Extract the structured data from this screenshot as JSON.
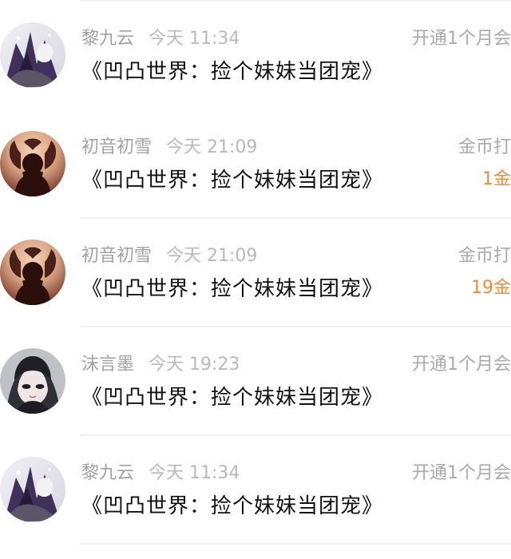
{
  "rows": [
    {
      "avatar": "silhouette-heart-avatar",
      "name": "初音初雪",
      "time": "今天 21:09",
      "title": "《凹凸世界：捡个妹妹当团宠》",
      "right_text": "金币打",
      "right_amount": "1金"
    },
    {
      "avatar": "silhouette-heart-avatar",
      "name": "初音初雪",
      "time": "今天 21:09",
      "title": "《凹凸世界：捡个妹妹当团宠》",
      "right_text": "金币打",
      "right_amount": "19金"
    },
    {
      "avatar": "anime-girl-avatar",
      "name": "沫言墨",
      "time": "今天 19:23",
      "title": "《凹凸世界：捡个妹妹当团宠》",
      "right_text": "开通1个月会",
      "right_amount": ""
    },
    {
      "avatar": "anime-dark-avatar",
      "name": "黎九云",
      "time": "今天 11:34",
      "title": "《凹凸世界：捡个妹妹当团宠》",
      "right_text": "开通1个月会",
      "right_amount": ""
    },
    {
      "avatar": "anime-dark-avatar",
      "name": "黎九云",
      "time": "今天 11:34",
      "title": "《凹凸世界：捡个妹妹当团宠》",
      "right_text": "开通1个月会",
      "right_amount": ""
    }
  ],
  "colors": {
    "name": "#a1a1a1",
    "time": "#b9b9b9",
    "title": "#111111",
    "right_text": "#a9a9a9",
    "amount": "#f08a36",
    "divider": "#f1f1f1"
  }
}
